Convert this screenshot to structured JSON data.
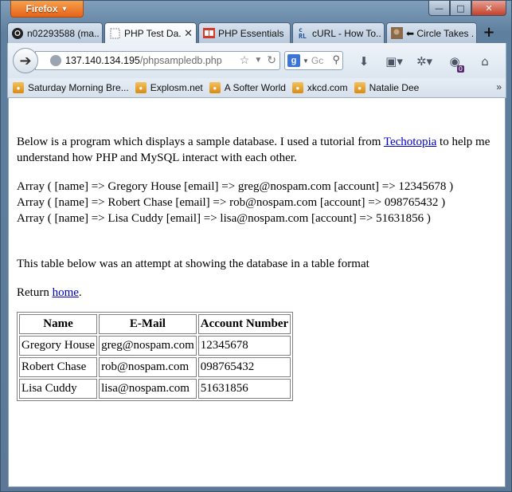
{
  "browser": {
    "menu_button": "Firefox",
    "tabs": [
      {
        "label": "n02293588 (ma...",
        "icon": "github-icon",
        "active": false
      },
      {
        "label": "PHP Test Da...",
        "icon": "blank-page-icon",
        "active": true
      },
      {
        "label": "PHP Essentials ...",
        "icon": "book-icon",
        "active": false
      },
      {
        "label": "cURL - How To...",
        "icon": "curl-icon",
        "active": false
      },
      {
        "label": "⬅ Circle Takes ...",
        "icon": "image-icon",
        "active": false
      }
    ],
    "url_host": "137.140.134.195",
    "url_path": "/phpsampledb.php",
    "search_placeholder": "Gc",
    "search_engine_letter": "g",
    "notification_count": "0",
    "bookmarks": [
      "Saturday Morning Bre...",
      "Explosm.net",
      "A Softer World",
      "xkcd.com",
      "Natalie Dee"
    ]
  },
  "page": {
    "intro_before_link": "Below is a program which displays a sample database. I used a tutorial from ",
    "intro_link": "Techotopia",
    "intro_after_link": " to help me understand how PHP and MySQL interact with each other.",
    "arrays": [
      "Array ( [name] => Gregory House [email] => greg@nospam.com [account] => 12345678 )",
      "Array ( [name] => Robert Chase [email] => rob@nospam.com [account] => 098765432 )",
      "Array ( [name] => Lisa Cuddy [email] => lisa@nospam.com [account] => 51631856 )"
    ],
    "table_note": "This table below was an attempt at showing the database in a table format",
    "return_before": "Return ",
    "return_link": "home",
    "return_after": ".",
    "table": {
      "headers": [
        "Name",
        "E-Mail",
        "Account Number"
      ],
      "rows": [
        [
          "Gregory House",
          "greg@nospam.com",
          "12345678"
        ],
        [
          "Robert Chase",
          "rob@nospam.com",
          "098765432"
        ],
        [
          "Lisa Cuddy",
          "lisa@nospam.com",
          "51631856"
        ]
      ]
    }
  }
}
